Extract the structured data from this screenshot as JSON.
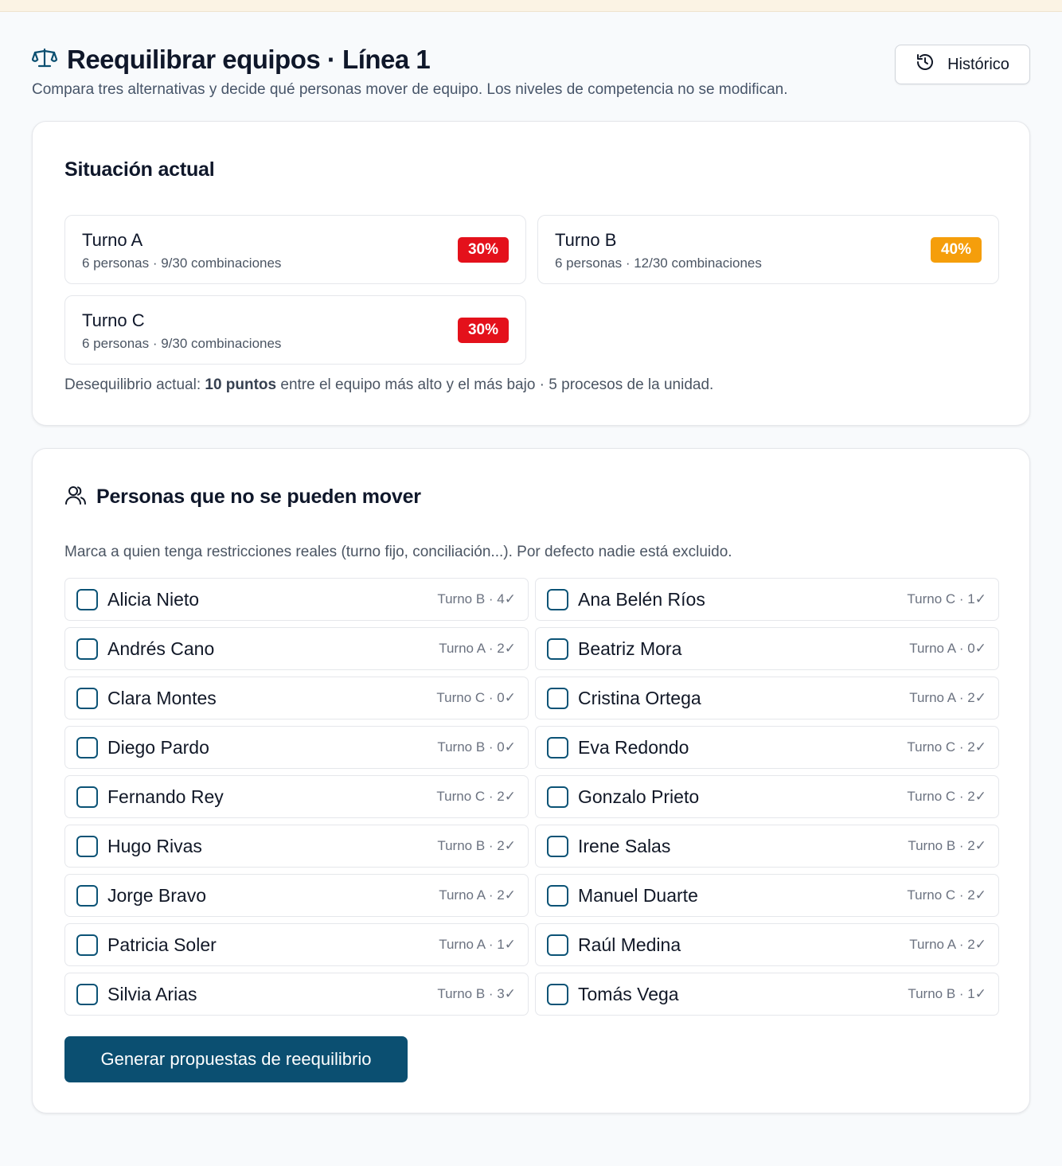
{
  "page": {
    "title": "Reequilibrar equipos · Línea 1",
    "subtitle": "Compara tres alternativas y decide qué personas mover de equipo. Los niveles de competencia no se modifican.",
    "history_label": "Histórico"
  },
  "colors": {
    "accent": "#0b4f71",
    "badge_red": "#e4111b",
    "badge_orange": "#f59e0b"
  },
  "current": {
    "heading": "Situación actual",
    "shifts": [
      {
        "name": "Turno A",
        "meta": "6 personas · 9/30 combinaciones",
        "pct": "30%",
        "color": "#e4111b"
      },
      {
        "name": "Turno B",
        "meta": "6 personas · 12/30 combinaciones",
        "pct": "40%",
        "color": "#f59e0b"
      },
      {
        "name": "Turno C",
        "meta": "6 personas · 9/30 combinaciones",
        "pct": "30%",
        "color": "#e4111b"
      }
    ],
    "summary_prefix": "Desequilibrio actual: ",
    "summary_bold": "10 puntos",
    "summary_suffix": " entre el equipo más alto y el más bajo · 5 procesos de la unidad."
  },
  "locked": {
    "heading": "Personas que no se pueden mover",
    "description": "Marca a quien tenga restricciones reales (turno fijo, conciliación...). Por defecto nadie está excluido.",
    "people": [
      {
        "name": "Alicia Nieto",
        "meta": "Turno B · 4✓",
        "checked": false
      },
      {
        "name": "Ana Belén Ríos",
        "meta": "Turno C · 1✓",
        "checked": false
      },
      {
        "name": "Andrés Cano",
        "meta": "Turno A · 2✓",
        "checked": false
      },
      {
        "name": "Beatriz Mora",
        "meta": "Turno A · 0✓",
        "checked": false
      },
      {
        "name": "Clara Montes",
        "meta": "Turno C · 0✓",
        "checked": false
      },
      {
        "name": "Cristina Ortega",
        "meta": "Turno A · 2✓",
        "checked": false
      },
      {
        "name": "Diego Pardo",
        "meta": "Turno B · 0✓",
        "checked": false
      },
      {
        "name": "Eva Redondo",
        "meta": "Turno C · 2✓",
        "checked": false
      },
      {
        "name": "Fernando Rey",
        "meta": "Turno C · 2✓",
        "checked": false
      },
      {
        "name": "Gonzalo Prieto",
        "meta": "Turno C · 2✓",
        "checked": false
      },
      {
        "name": "Hugo Rivas",
        "meta": "Turno B · 2✓",
        "checked": false
      },
      {
        "name": "Irene Salas",
        "meta": "Turno B · 2✓",
        "checked": false
      },
      {
        "name": "Jorge Bravo",
        "meta": "Turno A · 2✓",
        "checked": false
      },
      {
        "name": "Manuel Duarte",
        "meta": "Turno C · 2✓",
        "checked": false
      },
      {
        "name": "Patricia Soler",
        "meta": "Turno A · 1✓",
        "checked": false
      },
      {
        "name": "Raúl Medina",
        "meta": "Turno A · 2✓",
        "checked": false
      },
      {
        "name": "Silvia Arias",
        "meta": "Turno B · 3✓",
        "checked": false
      },
      {
        "name": "Tomás Vega",
        "meta": "Turno B · 1✓",
        "checked": false
      }
    ],
    "generate_label": "Generar propuestas de reequilibrio"
  }
}
